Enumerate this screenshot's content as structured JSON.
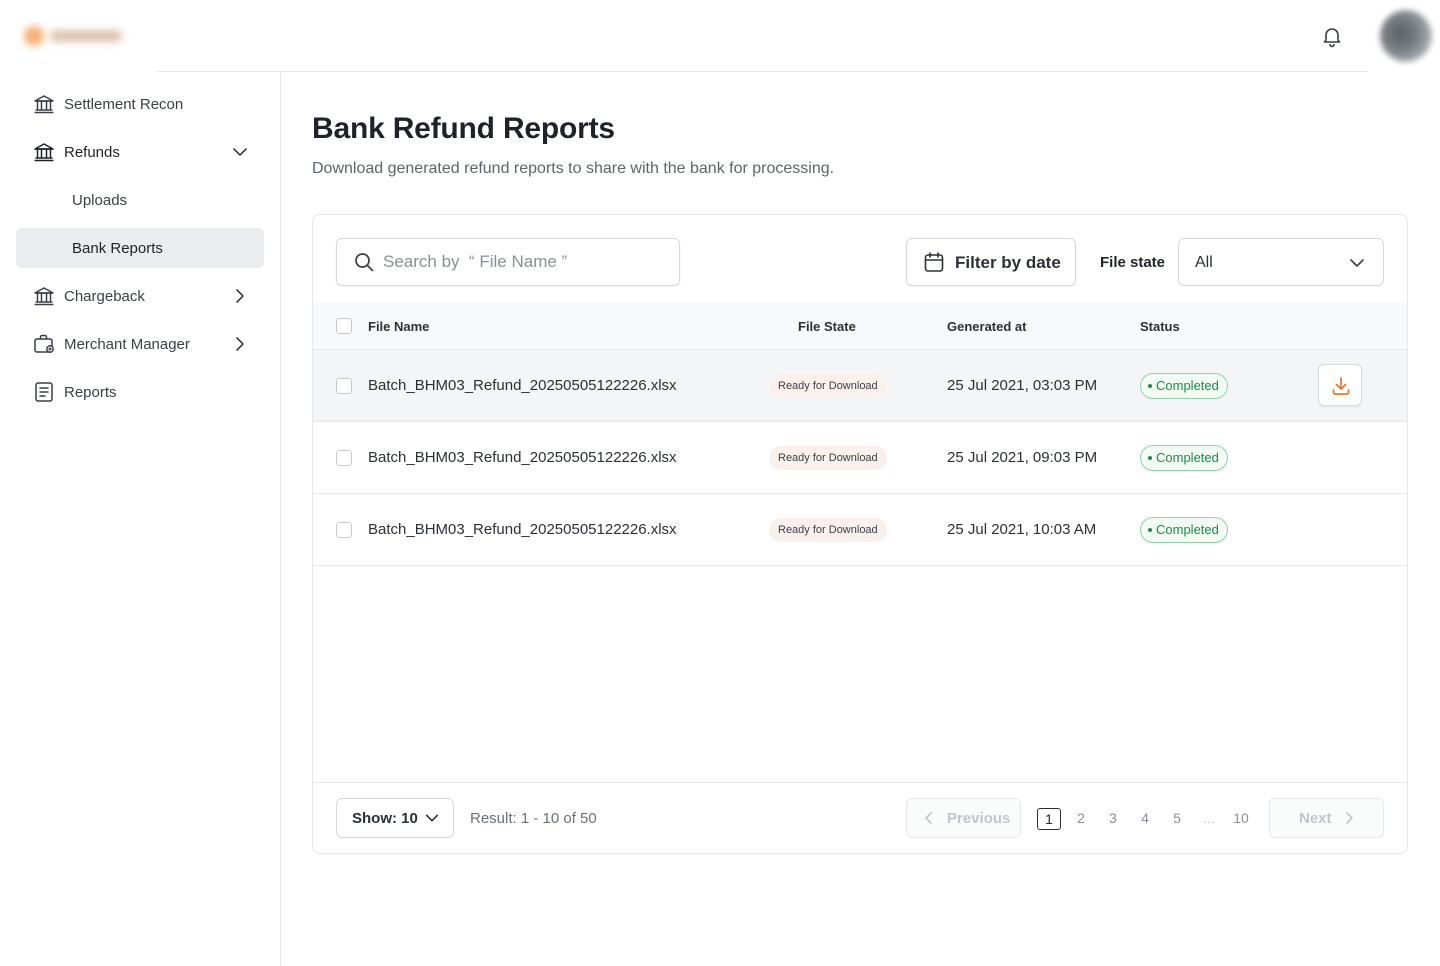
{
  "header": {
    "logo": "logo",
    "bell_icon": "bell-icon",
    "avatar": "user-avatar"
  },
  "sidebar": {
    "items": [
      {
        "label": "Settlement Recon",
        "icon": "bank-icon"
      },
      {
        "label": "Refunds",
        "icon": "bank-icon",
        "expanded": true
      },
      {
        "label": "Uploads"
      },
      {
        "label": "Bank Reports",
        "active": true
      },
      {
        "label": "Chargeback",
        "icon": "bank-icon"
      },
      {
        "label": "Merchant Manager",
        "icon": "briefcase-icon"
      },
      {
        "label": "Reports",
        "icon": "document-icon"
      }
    ]
  },
  "page": {
    "title": "Bank Refund Reports",
    "subtitle": "Download generated refund reports to share with the bank for processing."
  },
  "toolbar": {
    "search_placeholder": "Search by  “ File Name ”",
    "filter_label": "Filter by date",
    "file_state_label": "File state",
    "file_state_value": "All"
  },
  "table": {
    "columns": [
      "File Name",
      "File State",
      "Generated at",
      "Status"
    ],
    "rows": [
      {
        "file_name": "Batch_BHM03_Refund_20250505122226.xlsx",
        "file_state": "Ready for Download",
        "generated_at": "25 Jul 2021, 03:03 PM",
        "status": "Completed"
      },
      {
        "file_name": "Batch_BHM03_Refund_20250505122226.xlsx",
        "file_state": "Ready for Download",
        "generated_at": "25 Jul 2021, 09:03 PM",
        "status": "Completed"
      },
      {
        "file_name": "Batch_BHM03_Refund_20250505122226.xlsx",
        "file_state": "Ready for Download",
        "generated_at": "25 Jul 2021, 10:03 AM",
        "status": "Completed"
      }
    ]
  },
  "footer": {
    "show_label": "Show: 10",
    "result_text": "Result: 1 - 10 of 50",
    "previous_label": "Previous",
    "next_label": "Next",
    "pages": [
      "1",
      "2",
      "3",
      "4",
      "5",
      "...",
      "10"
    ],
    "current_page": "1"
  },
  "colors": {
    "accent": "#e8762d",
    "status_green": "#1f8a4c",
    "active_nav_bg": "#ebecee"
  }
}
